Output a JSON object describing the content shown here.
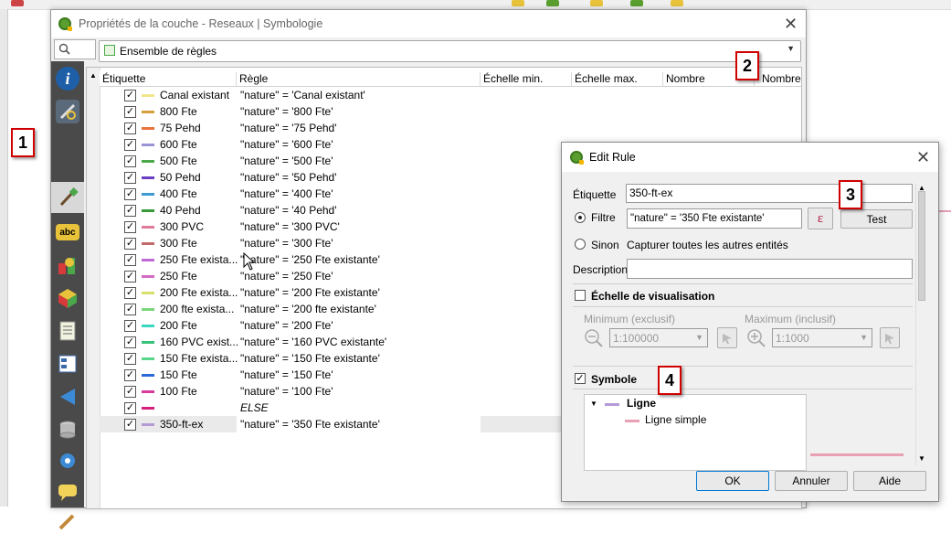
{
  "main_dialog": {
    "title": "Propriétés de la couche - Reseaux | Symbologie",
    "renderer": "Ensemble de règles",
    "columns": [
      "Étiquette",
      "Règle",
      "Échelle min.",
      "Échelle max.",
      "Nombre",
      "Nombre"
    ],
    "rules": [
      {
        "label": "Canal existant",
        "rule": "\"nature\" = 'Canal existant'",
        "color": "#f0e68c"
      },
      {
        "label": "800 Fte",
        "rule": "\"nature\" = '800 Fte'",
        "color": "#d4a03c"
      },
      {
        "label": "75 Pehd",
        "rule": "\"nature\" = '75 Pehd'",
        "color": "#e8743b"
      },
      {
        "label": "600 Fte",
        "rule": "\"nature\" = '600 Fte'",
        "color": "#9a94d6"
      },
      {
        "label": "500 Fte",
        "rule": "\"nature\" = '500 Fte'",
        "color": "#4aa84a"
      },
      {
        "label": "50 Pehd",
        "rule": "\"nature\" = '50 Pehd'",
        "color": "#6a3fc2"
      },
      {
        "label": "400 Fte",
        "rule": "\"nature\" = '400 Fte'",
        "color": "#3c9ad6"
      },
      {
        "label": "40 Pehd",
        "rule": "\"nature\" = '40 Pehd'",
        "color": "#3a9a3a"
      },
      {
        "label": "300 PVC",
        "rule": "\"nature\" = '300 PVC'",
        "color": "#e07a9a"
      },
      {
        "label": "300 Fte",
        "rule": "\"nature\" = '300 Fte'",
        "color": "#c26a6a"
      },
      {
        "label": "250 Fte exista...",
        "rule": "\"nature\" = '250 Fte existante'",
        "color": "#c06ad6"
      },
      {
        "label": "250 Fte",
        "rule": "\"nature\" = '250 Fte'",
        "color": "#d66ac2"
      },
      {
        "label": "200 Fte exista...",
        "rule": "\"nature\" = '200 Fte existante'",
        "color": "#d6e06a"
      },
      {
        "label": "200 fte exista...",
        "rule": "\"nature\" = '200 fte existante'",
        "color": "#7ad67a"
      },
      {
        "label": "200 Fte",
        "rule": "\"nature\" = '200 Fte'",
        "color": "#3ad6c2"
      },
      {
        "label": "160 PVC exist...",
        "rule": "\"nature\" = '160 PVC existante'",
        "color": "#3ac27a"
      },
      {
        "label": "150 Fte exista...",
        "rule": "\"nature\" = '150 Fte existante'",
        "color": "#5ad68a"
      },
      {
        "label": "150 Fte",
        "rule": "\"nature\" = '150 Fte'",
        "color": "#2a6ad6"
      },
      {
        "label": "100 Fte",
        "rule": "\"nature\" = '100 Fte'",
        "color": "#d63a9a"
      },
      {
        "label": "",
        "rule": "ELSE",
        "color": "#d6207a"
      },
      {
        "label": "350-ft-ex",
        "rule": "\"nature\" = '350 Fte existante'",
        "color": "#b49ad6"
      }
    ]
  },
  "callouts": [
    "1",
    "2",
    "3",
    "4"
  ],
  "edit_rule": {
    "title": "Edit Rule",
    "label_caption": "Étiquette",
    "label_value": "350-ft-ex",
    "filter_caption": "Filtre",
    "filter_value": "\"nature\" = '350 Fte existante'",
    "expr_button": "ε",
    "test_button": "Test",
    "else_caption": "Sinon",
    "else_text": "Capturer toutes les autres entités",
    "description_caption": "Description",
    "scale_group": "Échelle de visualisation",
    "min_caption": "Minimum (exclusif)",
    "max_caption": "Maximum (inclusif)",
    "min_value": "1:100000",
    "max_value": "1:1000",
    "symbol_group": "Symbole",
    "symbol_root": "Ligne",
    "symbol_layer": "Ligne simple",
    "symbol_color": "#e8a0b4",
    "ok": "OK",
    "cancel": "Annuler",
    "help": "Aide"
  }
}
